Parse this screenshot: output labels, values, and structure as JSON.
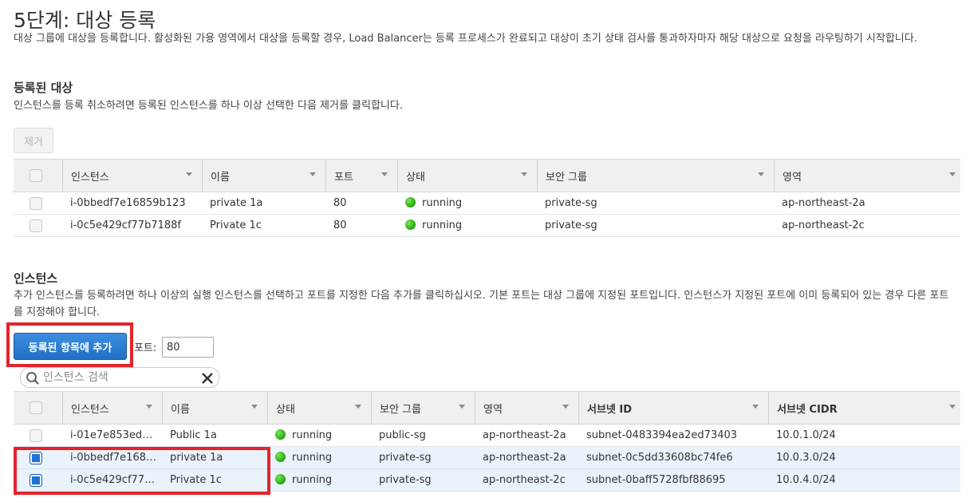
{
  "page": {
    "title": "5단계: 대상 등록",
    "description": "대상 그룹에 대상을 등록합니다. 활성화된 가용 영역에서 대상을 등록할 경우, Load Balancer는 등록 프로세스가 완료되고 대상이 초기 상태 검사를 통과하자마자 해당 대상으로 요청을 라우팅하기 시작합니다."
  },
  "registered": {
    "heading": "등록된 대상",
    "description": "인스턴스를 등록 취소하려면 등록된 인스턴스를 하나 이상 선택한 다음 제거를 클릭합니다.",
    "remove_label": "제거",
    "columns": [
      "인스턴스",
      "이름",
      "포트",
      "상태",
      "보안 그룹",
      "영역"
    ],
    "rows": [
      {
        "instance": "i-0bbedf7e16859b123",
        "name": "private 1a",
        "port": "80",
        "status": "running",
        "sg": "private-sg",
        "zone": "ap-northeast-2a"
      },
      {
        "instance": "i-0c5e429cf77b7188f",
        "name": "Private 1c",
        "port": "80",
        "status": "running",
        "sg": "private-sg",
        "zone": "ap-northeast-2c"
      }
    ]
  },
  "instances": {
    "heading": "인스턴스",
    "description": "추가 인스턴스를 등록하려면 하나 이상의 실행 인스턴스를 선택하고 포트를 지정한 다음 추가를 클릭하십시오. 기본 포트는 대상 그룹에 지정된 포트입니다. 인스턴스가 지정된 포트에 이미 등록되어 있는 경우 다른 포트를 지정해야 합니다.",
    "add_label": "등록된 항목에 추가",
    "port_label": "포트:",
    "port_value": "80",
    "search_placeholder": "인스턴스 검색",
    "columns": [
      "인스턴스",
      "이름",
      "상태",
      "보안 그룹",
      "영역",
      "서브넷 ID",
      "서브넷 CIDR"
    ],
    "rows": [
      {
        "instance": "i-01e7e853edbf...",
        "name": "Public 1a",
        "status": "running",
        "sg": "public-sg",
        "zone": "ap-northeast-2a",
        "subnet": "subnet-0483394ea2ed73403",
        "cidr": "10.0.1.0/24",
        "selected": false
      },
      {
        "instance": "i-0bbedf7e1685...",
        "name": "private 1a",
        "status": "running",
        "sg": "private-sg",
        "zone": "ap-northeast-2a",
        "subnet": "subnet-0c5dd33608bc74fe6",
        "cidr": "10.0.3.0/24",
        "selected": true
      },
      {
        "instance": "i-0c5e429cf77b7...",
        "name": "Private 1c",
        "status": "running",
        "sg": "private-sg",
        "zone": "ap-northeast-2c",
        "subnet": "subnet-0baff5728fbf88695",
        "cidr": "10.0.4.0/24",
        "selected": true
      }
    ]
  },
  "colors": {
    "primary": "#1f6fc4",
    "highlight": "#e3242b",
    "running": "#22a60b",
    "selected_row": "#eaf3fb"
  }
}
